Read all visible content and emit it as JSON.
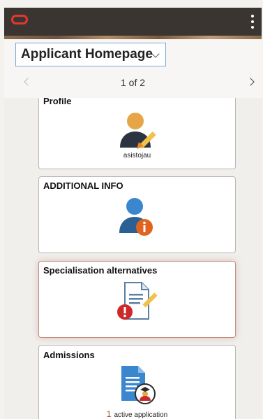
{
  "header": {
    "logo_icon": "oracle-logo-icon",
    "menu_icon": "kebab-menu-icon"
  },
  "page_selector": {
    "title": "Applicant Homepage"
  },
  "pager": {
    "label": "1 of 2"
  },
  "tiles": [
    {
      "title": "Profile",
      "icon": "user-edit-icon",
      "subtitle": "asistojau"
    },
    {
      "title": "ADDITIONAL INFO",
      "icon": "user-info-icon"
    },
    {
      "title": "Specialisation alternatives",
      "icon": "document-edit-alert-icon"
    },
    {
      "title": "Admissions",
      "icon": "document-graduate-icon",
      "count": "1",
      "count_label": "active application"
    }
  ],
  "colors": {
    "accent_orange": "#e0641f",
    "icon_blue": "#3a86cf",
    "alert_red": "#cc2a2a",
    "header_bg": "#3b3531"
  }
}
